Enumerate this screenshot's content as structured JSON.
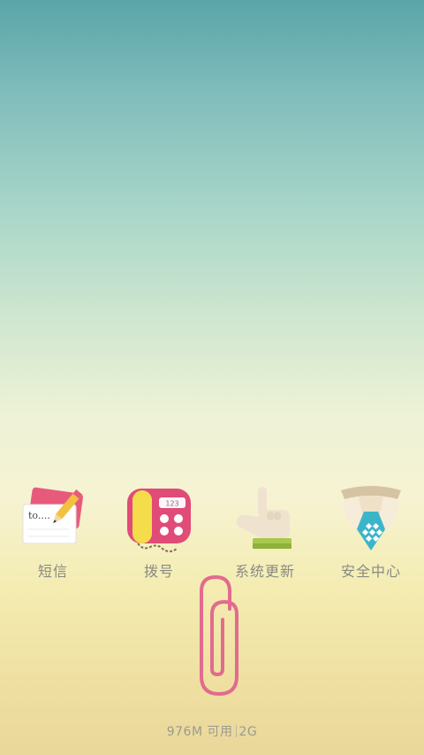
{
  "dock": {
    "apps": [
      {
        "label": "短信",
        "icon": "sms-icon"
      },
      {
        "label": "拨号",
        "icon": "phone-dialer-icon"
      },
      {
        "label": "系统更新",
        "icon": "system-update-icon"
      },
      {
        "label": "安全中心",
        "icon": "security-center-icon"
      }
    ]
  },
  "status": {
    "memory_available": "976M 可用",
    "memory_total": "2G"
  },
  "colors": {
    "sms_accent": "#e85a7c",
    "dialer_body": "#e04b78",
    "dialer_handset": "#f4dc4a",
    "security_blue": "#3bb6c8",
    "paperclip": "#e26b8e"
  }
}
